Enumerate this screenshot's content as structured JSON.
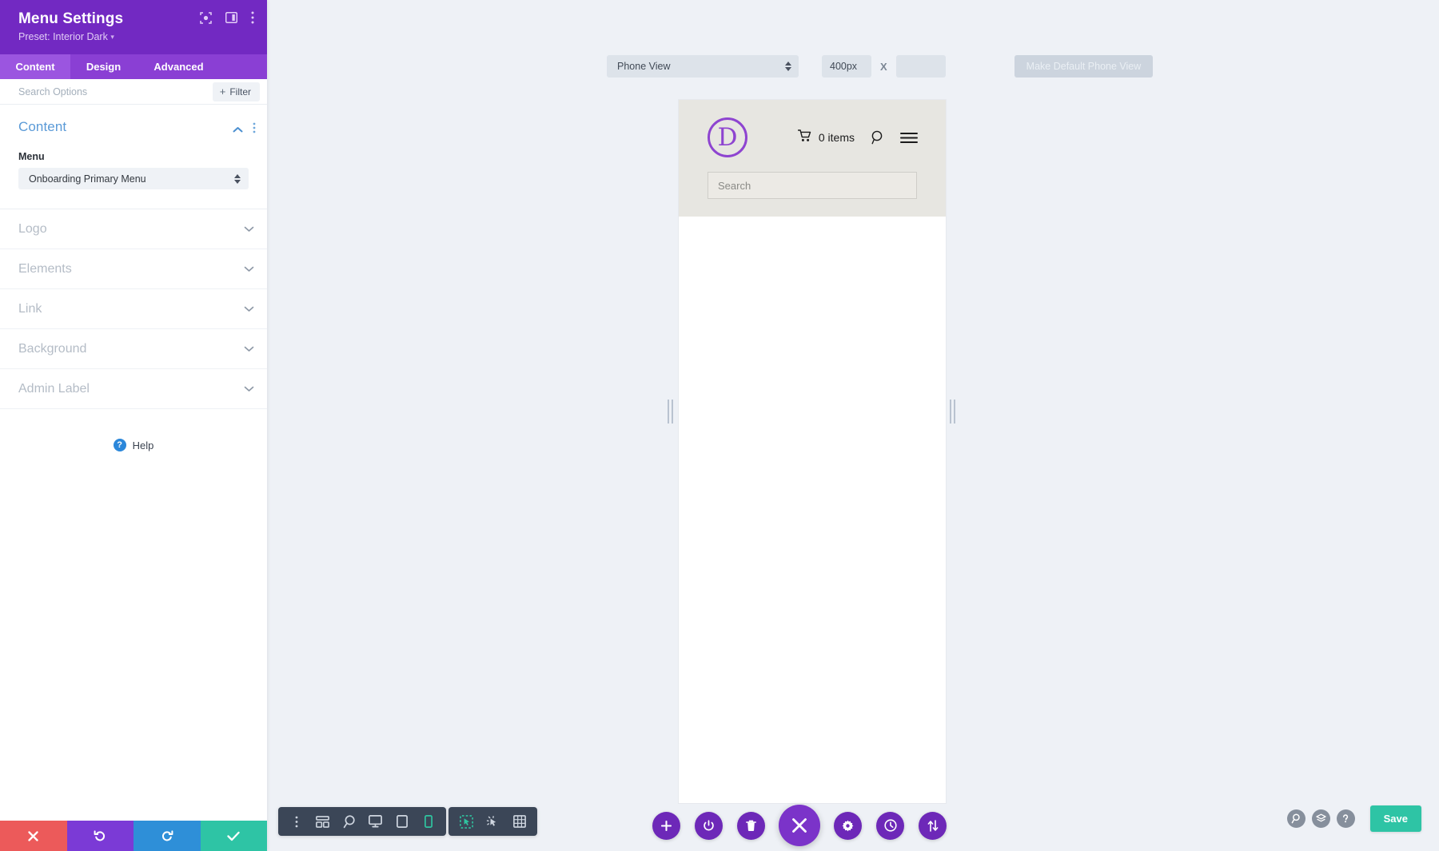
{
  "panel": {
    "title": "Menu Settings",
    "preset_label": "Preset: Interior Dark",
    "preset_caret": "▾",
    "header_icons": [
      {
        "name": "focus-target-icon",
        "glyph": "target"
      },
      {
        "name": "panel-layout-icon",
        "glyph": "layout"
      },
      {
        "name": "kebab-menu-icon",
        "glyph": "kebab"
      }
    ],
    "tabs": [
      {
        "label": "Content",
        "active": true
      },
      {
        "label": "Design",
        "active": false
      },
      {
        "label": "Advanced",
        "active": false
      }
    ],
    "search": {
      "placeholder": "Search Options",
      "value": ""
    },
    "filter_button": {
      "plus": "+",
      "label": "Filter"
    },
    "content_section": {
      "title": "Content",
      "field_label": "Menu",
      "select_value": "Onboarding Primary Menu"
    },
    "accordions": [
      {
        "label": "Logo"
      },
      {
        "label": "Elements"
      },
      {
        "label": "Link"
      },
      {
        "label": "Background"
      },
      {
        "label": "Admin Label"
      }
    ],
    "help": {
      "icon_glyph": "?",
      "label": "Help"
    },
    "actions": [
      {
        "name": "cancel-button",
        "icon": "close-icon",
        "color": "#ec5a5a"
      },
      {
        "name": "undo-button",
        "icon": "undo-icon",
        "color": "#7b3ad6"
      },
      {
        "name": "redo-button",
        "icon": "redo-icon",
        "color": "#2e8fd8"
      },
      {
        "name": "apply-button",
        "icon": "check-icon",
        "color": "#2ec4a5"
      }
    ]
  },
  "toolbar": {
    "view_select_value": "Phone View",
    "width_value": "400px",
    "times_symbol": "X",
    "height_value": "",
    "height_placeholder": "",
    "make_default_label": "Make Default Phone View"
  },
  "preview": {
    "logo_letter": "D",
    "cart_text": "0 items",
    "search_placeholder": "Search",
    "icons": [
      {
        "name": "cart-icon"
      },
      {
        "name": "search-icon"
      },
      {
        "name": "hamburger-menu-icon"
      }
    ]
  },
  "bottom_bar": {
    "group_one": [
      {
        "name": "kebab-menu-icon"
      },
      {
        "name": "wireframe-view-icon"
      },
      {
        "name": "zoom-view-icon"
      },
      {
        "name": "desktop-view-icon"
      },
      {
        "name": "tablet-view-icon"
      },
      {
        "name": "phone-view-icon",
        "active": true
      }
    ],
    "group_two": [
      {
        "name": "click-select-icon",
        "active": true
      },
      {
        "name": "hover-select-icon"
      },
      {
        "name": "grid-view-icon"
      }
    ],
    "center_buttons": [
      {
        "name": "add-module-button",
        "icon": "plus-icon"
      },
      {
        "name": "toggle-builder-button",
        "icon": "power-icon"
      },
      {
        "name": "trash-button",
        "icon": "trash-icon"
      },
      {
        "name": "close-builder-button",
        "icon": "close-icon",
        "large": true
      },
      {
        "name": "settings-button",
        "icon": "gear-icon"
      },
      {
        "name": "history-button",
        "icon": "clock-icon"
      },
      {
        "name": "sort-button",
        "icon": "up-down-arrows-icon"
      }
    ],
    "right_buttons": [
      {
        "name": "search-button",
        "icon": "search-icon"
      },
      {
        "name": "layers-button",
        "icon": "layers-icon"
      },
      {
        "name": "help-button",
        "icon": "question-icon"
      }
    ],
    "save_label": "Save"
  },
  "colors": {
    "brand_purple": "#7229c2",
    "tab_bar": "#8a3fd4",
    "accent_blue": "#5a9ad7",
    "save_green": "#2ec4a5",
    "cancel_red": "#ec5a5a",
    "canvas_bg": "#eef1f6",
    "site_header_bg": "#e7e6e1",
    "divi_logo_purple": "#8e44d0",
    "dark_toolbar": "#3b4657"
  }
}
